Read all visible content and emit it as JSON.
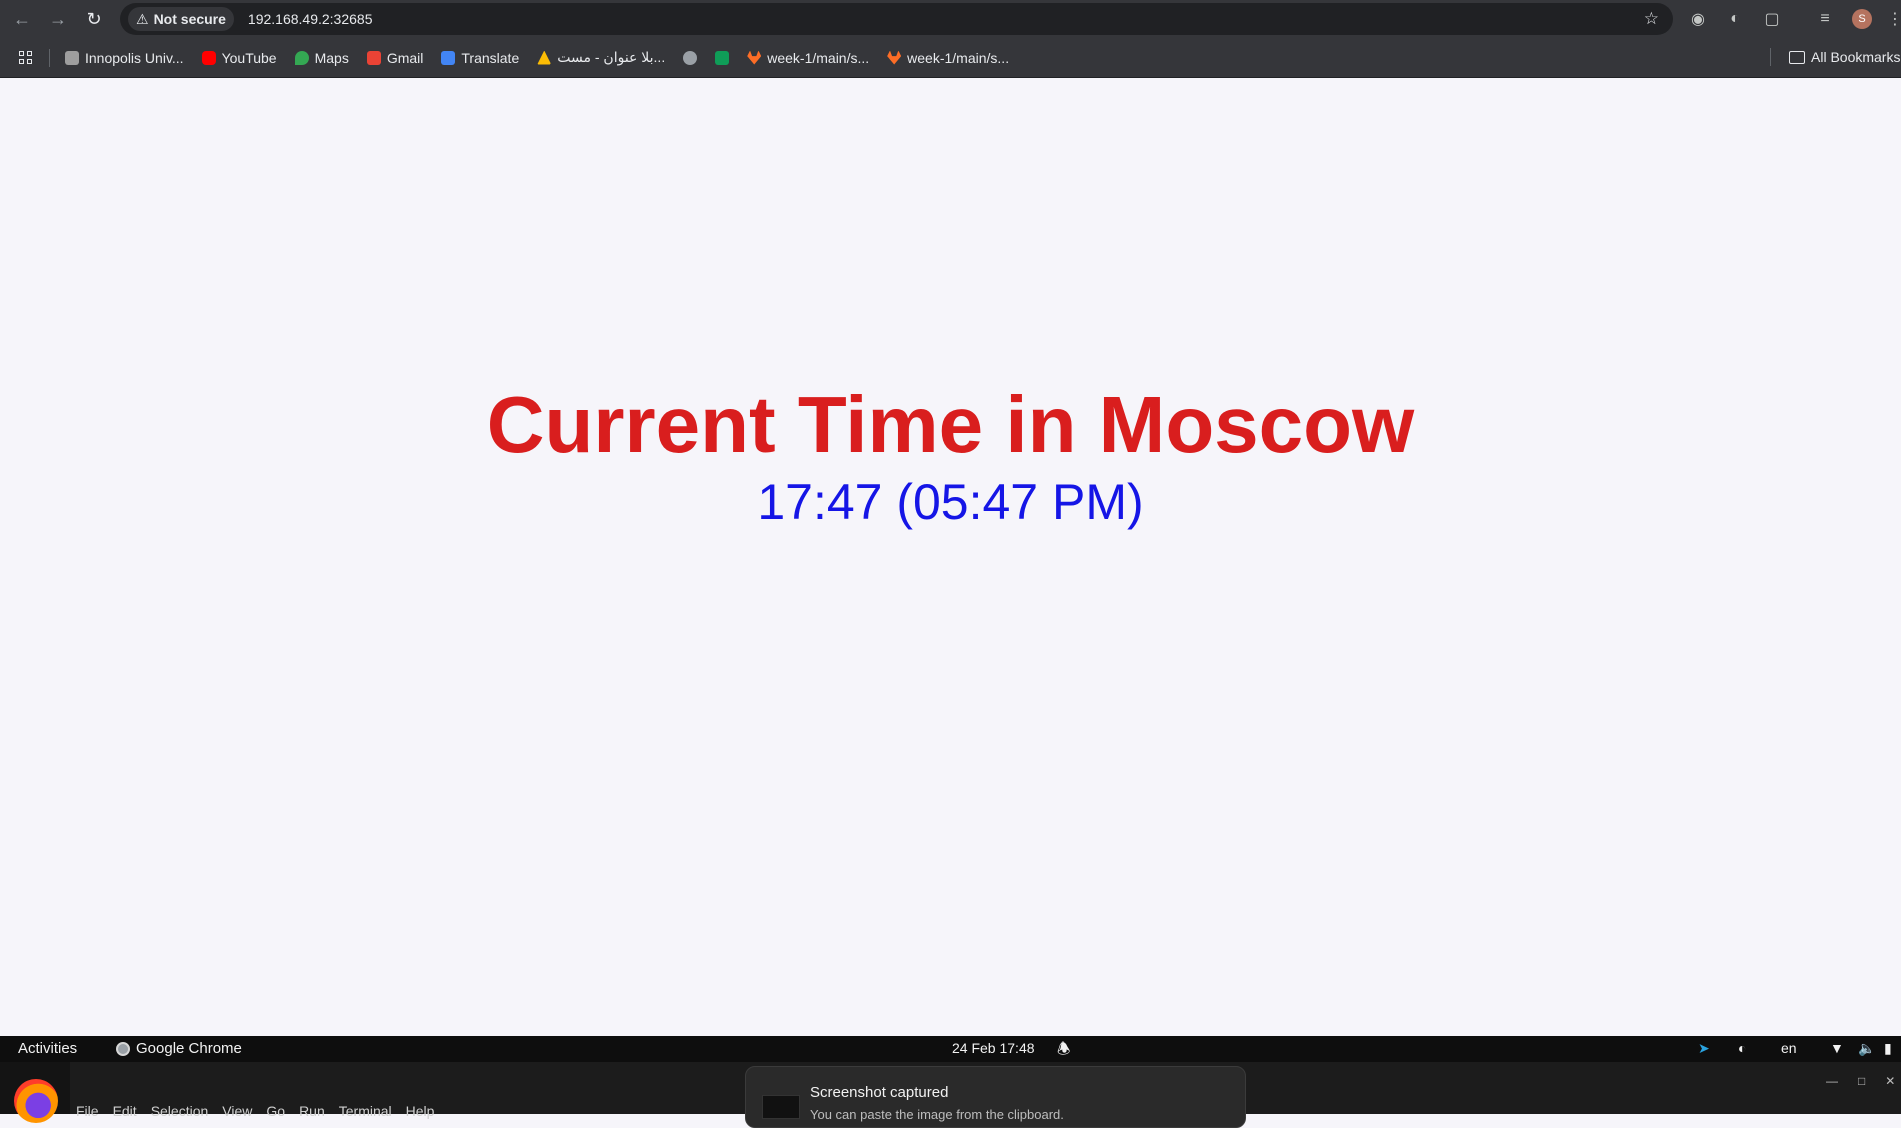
{
  "browser": {
    "security_label": "Not secure",
    "url": "192.168.49.2:32685",
    "avatar_letter": "S"
  },
  "bookmarks": {
    "items": [
      {
        "label": "Innopolis Univ...",
        "color": "#9e9e9e"
      },
      {
        "label": "YouTube",
        "color": "#ff0000"
      },
      {
        "label": "Maps",
        "color": "#34a853"
      },
      {
        "label": "Gmail",
        "color": "#ea4335"
      },
      {
        "label": "Translate",
        "color": "#4285f4"
      },
      {
        "label": "بلا عنوان - مست...",
        "color": "#fbbc04"
      },
      {
        "label": "",
        "color": "#9aa0a6"
      },
      {
        "label": "",
        "color": "#0f9d58"
      },
      {
        "label": "week-1/main/s...",
        "color": "#fc6d26"
      },
      {
        "label": "week-1/main/s...",
        "color": "#fc6d26"
      }
    ],
    "all_bookmarks": "All Bookmarks"
  },
  "page": {
    "heading": "Current Time in Moscow",
    "time": "17:47 (05:47 PM)",
    "heading_color": "#d91e1e",
    "time_color": "#1515e6"
  },
  "topbar": {
    "activities": "Activities",
    "app_name": "Google Chrome",
    "clock": "24 Feb  17:48",
    "language": "en"
  },
  "lower_window": {
    "menu": [
      "File",
      "Edit",
      "Selection",
      "View",
      "Go",
      "Run",
      "Terminal",
      "Help"
    ]
  },
  "notification": {
    "title": "Screenshot captured",
    "subtitle": "You can paste the image from the clipboard."
  }
}
